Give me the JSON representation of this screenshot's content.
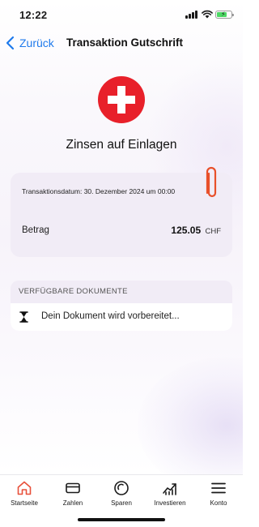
{
  "status_bar": {
    "time": "12:22",
    "icons": [
      "signal-icon",
      "wifi-icon",
      "battery-charging-icon"
    ]
  },
  "nav": {
    "back_label": "Zurück",
    "title": "Transaktion Gutschrift"
  },
  "header": {
    "icon": "swiss-flag-icon",
    "title": "Zinsen auf Einlagen"
  },
  "transaction": {
    "date_text": "Transaktionsdatum: 30. Dezember 2024 um 00:00",
    "amount_label": "Betrag",
    "amount_value": "125.05",
    "currency": "CHF",
    "attachment_icon": "paperclip-icon"
  },
  "documents": {
    "header": "VERFÜGBARE DOKUMENTE",
    "status_icon": "hourglass-icon",
    "status_text": "Dein Dokument wird vorbereitet..."
  },
  "tabbar": {
    "items": [
      {
        "label": "Startseite",
        "icon": "home-icon",
        "active": true
      },
      {
        "label": "Zahlen",
        "icon": "card-icon",
        "active": false
      },
      {
        "label": "Sparen",
        "icon": "savings-icon",
        "active": false
      },
      {
        "label": "Investieren",
        "icon": "chart-icon",
        "active": false
      },
      {
        "label": "Konto",
        "icon": "menu-icon",
        "active": false
      }
    ]
  },
  "colors": {
    "accent_blue": "#1f7aec",
    "flag_red": "#e8202a",
    "home_orange": "#e8503a",
    "card_background": "#f1ecf6"
  }
}
